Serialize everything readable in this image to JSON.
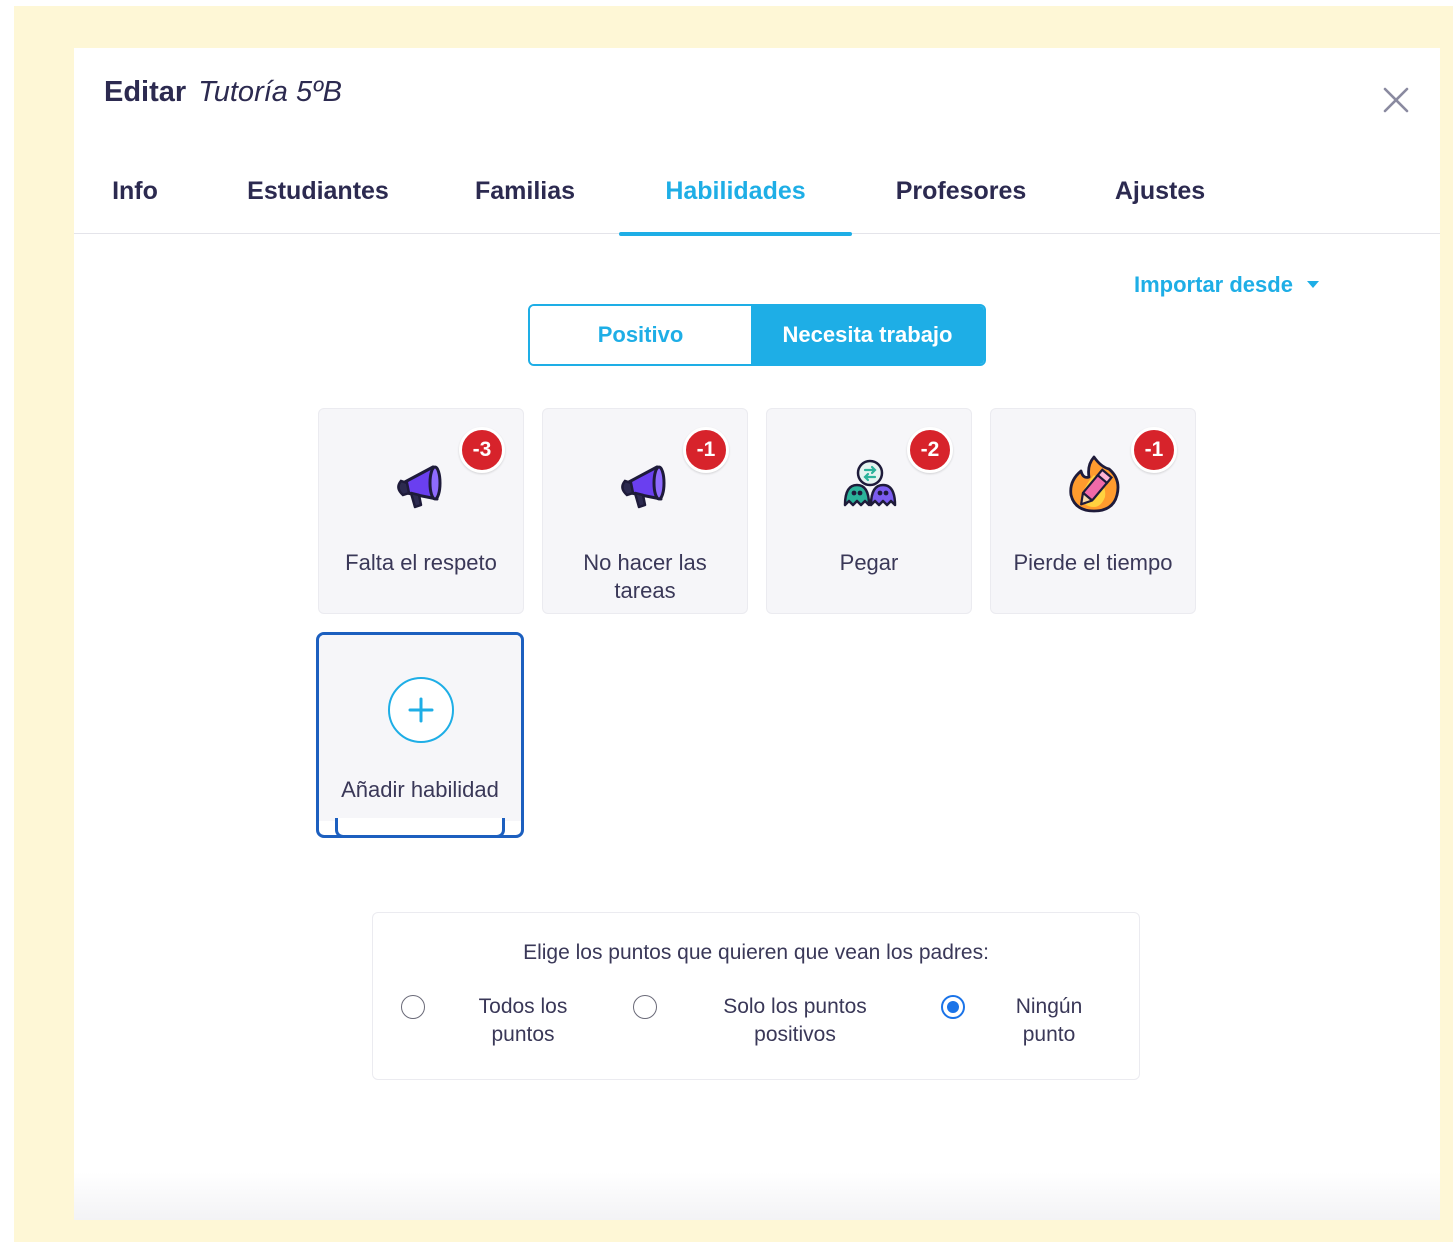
{
  "modal": {
    "title_prefix": "Editar",
    "class_name": "Tutoría 5ºB"
  },
  "tabs": [
    {
      "label": "Info"
    },
    {
      "label": "Estudiantes"
    },
    {
      "label": "Familias"
    },
    {
      "label": "Habilidades",
      "active": true
    },
    {
      "label": "Profesores"
    },
    {
      "label": "Ajustes"
    }
  ],
  "import_label": "Importar desde",
  "toggle": {
    "positive": "Positivo",
    "needs_work": "Necesita trabajo",
    "selected": "needs_work"
  },
  "skills": [
    {
      "label": "Falta el respeto",
      "points": "-3",
      "icon": "megaphone-icon"
    },
    {
      "label": "No hacer las tareas",
      "points": "-1",
      "icon": "megaphone-icon"
    },
    {
      "label": "Pegar",
      "points": "-2",
      "icon": "monsters-swap-icon"
    },
    {
      "label": "Pierde el tiempo",
      "points": "-1",
      "icon": "burning-pencil-icon"
    }
  ],
  "add_skill_label": "Añadir habilidad",
  "parents": {
    "prompt": "Elige los puntos que quieren que vean los padres:",
    "options": [
      {
        "label": "Todos los puntos",
        "checked": false
      },
      {
        "label": "Solo los puntos positivos",
        "checked": false
      },
      {
        "label": "Ningún punto",
        "checked": true
      }
    ]
  },
  "colors": {
    "accent": "#1eaee6",
    "badge": "#d7232b",
    "text": "#2c2a50",
    "frame": "#fef7d6",
    "focus": "#1c5fbf"
  }
}
